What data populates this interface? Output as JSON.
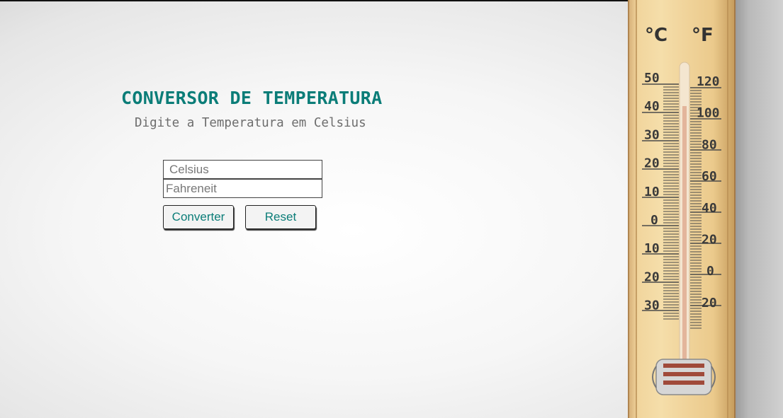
{
  "header": {
    "title": "CONVERSOR DE TEMPERATURA",
    "subtitle": "Digite a Temperatura em Celsius"
  },
  "form": {
    "celsius_placeholder": "Celsius",
    "fahrenheit_placeholder": "Fahreneit",
    "convert_label": "Converter",
    "reset_label": "Reset"
  },
  "thermometer": {
    "celsius_unit": "°C",
    "fahrenheit_unit": "°F",
    "celsius_marks": [
      "50",
      "40",
      "30",
      "20",
      "10",
      "0",
      "10",
      "20",
      "30"
    ],
    "fahrenheit_marks": [
      "120",
      "100",
      "80",
      "60",
      "40",
      "20",
      "0",
      "20"
    ]
  },
  "colors": {
    "accent": "#0b7d78",
    "subtitle": "#6d6d6d"
  }
}
